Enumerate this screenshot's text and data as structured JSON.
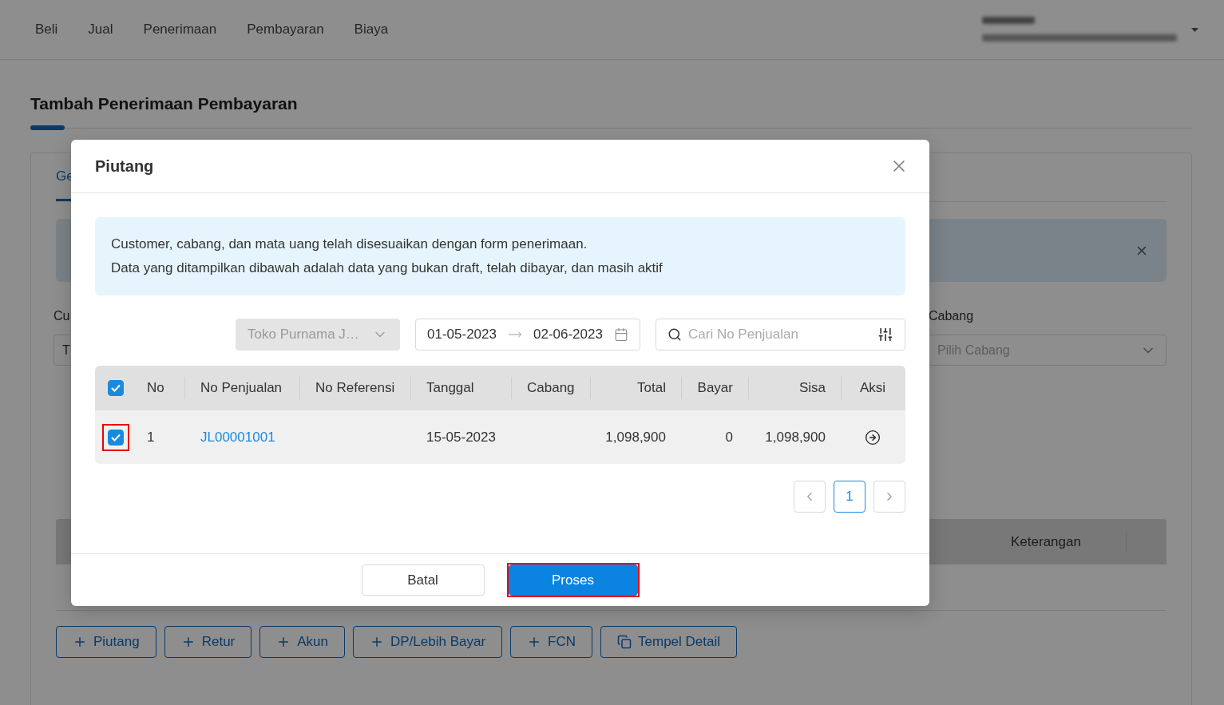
{
  "nav": {
    "items": [
      {
        "label": "Beli"
      },
      {
        "label": "Jual"
      },
      {
        "label": "Penerimaan"
      },
      {
        "label": "Pembayaran"
      },
      {
        "label": "Biaya"
      }
    ]
  },
  "page": {
    "title": "Tambah Penerimaan Pembayaran",
    "tabs": [
      {
        "label": "Ge",
        "selected": true
      }
    ],
    "fields": [
      {
        "kind": "input",
        "label": "Cu",
        "value": "T"
      },
      {
        "kind": "select",
        "label": "Cabang",
        "placeholder": "Pilih Cabang"
      }
    ],
    "detail_table": {
      "columns": [
        "Keterangan"
      ]
    },
    "add_buttons": [
      {
        "kind": "add",
        "label": "Piutang"
      },
      {
        "kind": "add",
        "label": "Retur"
      },
      {
        "kind": "add",
        "label": "Akun"
      },
      {
        "kind": "add",
        "label": "DP/Lebih Bayar"
      },
      {
        "kind": "add",
        "label": "FCN"
      },
      {
        "kind": "paste",
        "label": "Tempel Detail"
      }
    ]
  },
  "modal": {
    "title": "Piutang",
    "info": [
      "Customer, cabang, dan mata uang telah disesuaikan dengan form penerimaan.",
      "Data yang ditampilkan dibawah adalah data yang bukan draft, telah dibayar, dan masih aktif"
    ],
    "customer_select": {
      "value": "Toko Purnama J…",
      "disabled": true
    },
    "date_range": {
      "start": "01-05-2023",
      "end": "02-06-2023"
    },
    "search": {
      "placeholder": "Cari No Penjualan"
    },
    "table": {
      "all_checked": true,
      "columns": [
        "No",
        "No Penjualan",
        "No Referensi",
        "Tanggal",
        "Cabang",
        "Total",
        "Bayar",
        "Sisa",
        "Aksi"
      ],
      "rows": [
        {
          "checked": true,
          "highlighted": true,
          "no": "1",
          "no_penjualan": "JL00001001",
          "tanggal": "15-05-2023",
          "total": "1,098,900",
          "bayar": "0",
          "sisa": "1,098,900"
        }
      ]
    },
    "pagination": {
      "pages": [
        {
          "label": "1",
          "selected": true
        }
      ]
    },
    "buttons": [
      {
        "kind": "secondary",
        "label": "Batal",
        "highlighted": false
      },
      {
        "kind": "primary",
        "label": "Proses",
        "highlighted": true
      }
    ]
  }
}
